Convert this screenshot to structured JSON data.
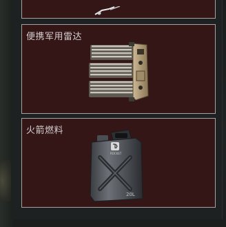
{
  "inventory": {
    "items": [
      {
        "name": "",
        "icon": "partial-item-icon"
      },
      {
        "name": "便携军用雷达",
        "icon": "portable-radar-icon"
      },
      {
        "name": "火箭燃料",
        "icon": "fuel-canister-icon",
        "canister_label": "20L"
      }
    ]
  },
  "colors": {
    "card_bg": "#341617",
    "card_border": "#a7a2a2",
    "panel_bg": "#1e2121",
    "title_text": "#d4cfcf"
  }
}
